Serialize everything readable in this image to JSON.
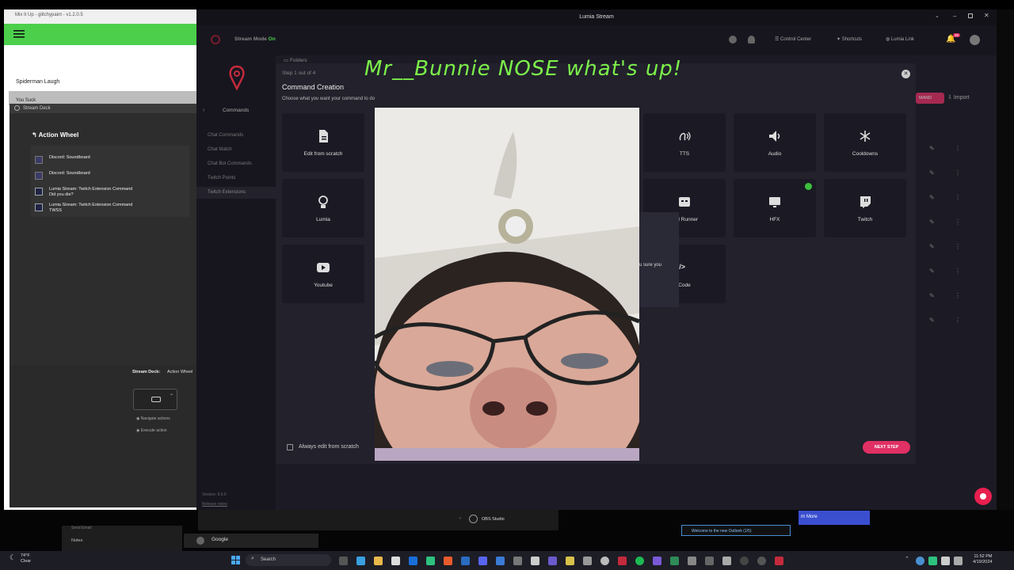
{
  "mix": {
    "title": "Mix It Up - glitchypaint - v1.2.0.5",
    "item1": "Spiderman Laugh",
    "item2": "You Suck",
    "streamdeck_tab": "Stream Deck"
  },
  "deck": {
    "action_wheel": "Action Wheel",
    "actions": [
      {
        "label": "Discord: Soundboard",
        "label2": ""
      },
      {
        "label": "Discord: Soundboard",
        "label2": ""
      },
      {
        "label": "Lumia Stream: Twitch Extension Command",
        "label2": "Did you die?"
      },
      {
        "label": "Lumia Stream: Twitch Extension Command",
        "label2": "TWSS"
      }
    ],
    "stream_deck_label": "Stream Deck:",
    "stream_deck_value": "Action Wheel",
    "navigate": "Navigate actions",
    "execute": "Execute action"
  },
  "lumia": {
    "window_title": "Lumia Stream",
    "stream_mode": "Stream Mode",
    "stream_mode_state": "On",
    "control_center": "Control Center",
    "shortcuts": "Shortcuts",
    "lumia_link": "Lumia Link",
    "notif_count": "20",
    "folders": "Folders",
    "import": "Import",
    "mand": "MAND",
    "version": "Version: 9.6.0",
    "release_notes": "Release notes",
    "sidebar": {
      "back_label": "Commands",
      "items": [
        "Chat Commands",
        "Chat Match",
        "Chat Bot Commands",
        "Twitch Points",
        "Twitch Extensions"
      ]
    }
  },
  "modal": {
    "step": "Step 1 out of 4",
    "title": "Command Creation",
    "subtitle": "Choose what you want your command to do",
    "cards": {
      "scratch": "Edit from scratch",
      "tts": "TTS",
      "audio": "Audio",
      "cooldowns": "Cooldowns",
      "lumia": "Lumia",
      "runner": "and Runner",
      "hfx": "HFX",
      "twitch": "Twitch",
      "youtube": "Youtube",
      "code": "Code",
      "code_icon": "</>"
    },
    "peek_text": "u sure you",
    "always_scratch": "Always edit from scratch",
    "next": "NEXT STEP"
  },
  "overlay": {
    "text": "Mr__Bunnie NOSE what's up!"
  },
  "bottom": {
    "obs": "OBS Studio",
    "outlook": "Welcome to the new Outlook (1/5)",
    "learn_more": "rn More",
    "google": "Google",
    "notes": "Notes",
    "send_email": "Send Email"
  },
  "taskbar": {
    "weather_temp": "74°F",
    "weather_desc": "Clear",
    "search": "Search",
    "time": "11:52 PM",
    "date": "4/19/2024"
  },
  "colors": {
    "accent": "#e03064",
    "green": "#4cd04c",
    "overlay": "#7cf04a",
    "modal_bg": "#22212c"
  }
}
